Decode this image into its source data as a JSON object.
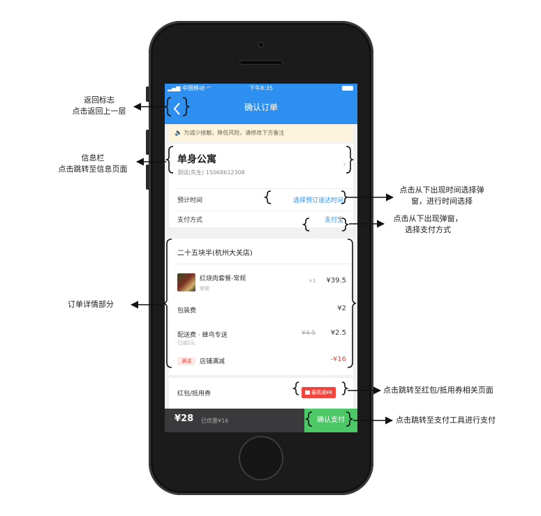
{
  "status_bar": {
    "carrier": "中国移动",
    "time": "下午8:35"
  },
  "nav": {
    "title": "确认订单",
    "back_icon": "chevron-left-icon"
  },
  "notice": {
    "text": "为减少接触，降低风险，请修改下方备注",
    "icon": "speaker-icon"
  },
  "address": {
    "name": "单身公寓",
    "contact": "测试(先生)  15068612308"
  },
  "delivery_time": {
    "label": "预计时间",
    "value": "选择预订送达时间"
  },
  "payment_method": {
    "label": "支付方式",
    "value": "支付宝"
  },
  "order": {
    "shop": "二十五块半(杭州大关店)",
    "item": {
      "name": "红烧肉套餐-常规",
      "spec": "常规",
      "qty": "×1",
      "price": "¥39.5"
    },
    "packing": {
      "label": "包装费",
      "price": "¥2"
    },
    "delivery": {
      "label": "配送费 · 蜂鸟专送",
      "note": "已减2元",
      "old_price": "¥4.5",
      "price": "¥2.5"
    },
    "discount": {
      "tag": "满减",
      "label": "店铺满减",
      "price": "-¥16"
    }
  },
  "coupon": {
    "label": "红包/抵用券",
    "badge": "最高减¥8"
  },
  "paybar": {
    "total": "¥28",
    "saved": "已优惠¥16",
    "button": "确认支付"
  },
  "annotations": {
    "back": [
      "返回标志",
      "点击返回上一层"
    ],
    "info": [
      "信息栏",
      "点击跳转至信息页面"
    ],
    "time": [
      "点击从下出现时间选择弹",
      "窗，进行时间选择"
    ],
    "pay_method": [
      "点击从下出现弹窗，",
      "选择支付方式"
    ],
    "order_detail": [
      "订单详情部分"
    ],
    "coupon": [
      "点击跳转至红包/抵用券相关页面"
    ],
    "pay_button": [
      "点击跳转至支付工具进行支付"
    ]
  }
}
